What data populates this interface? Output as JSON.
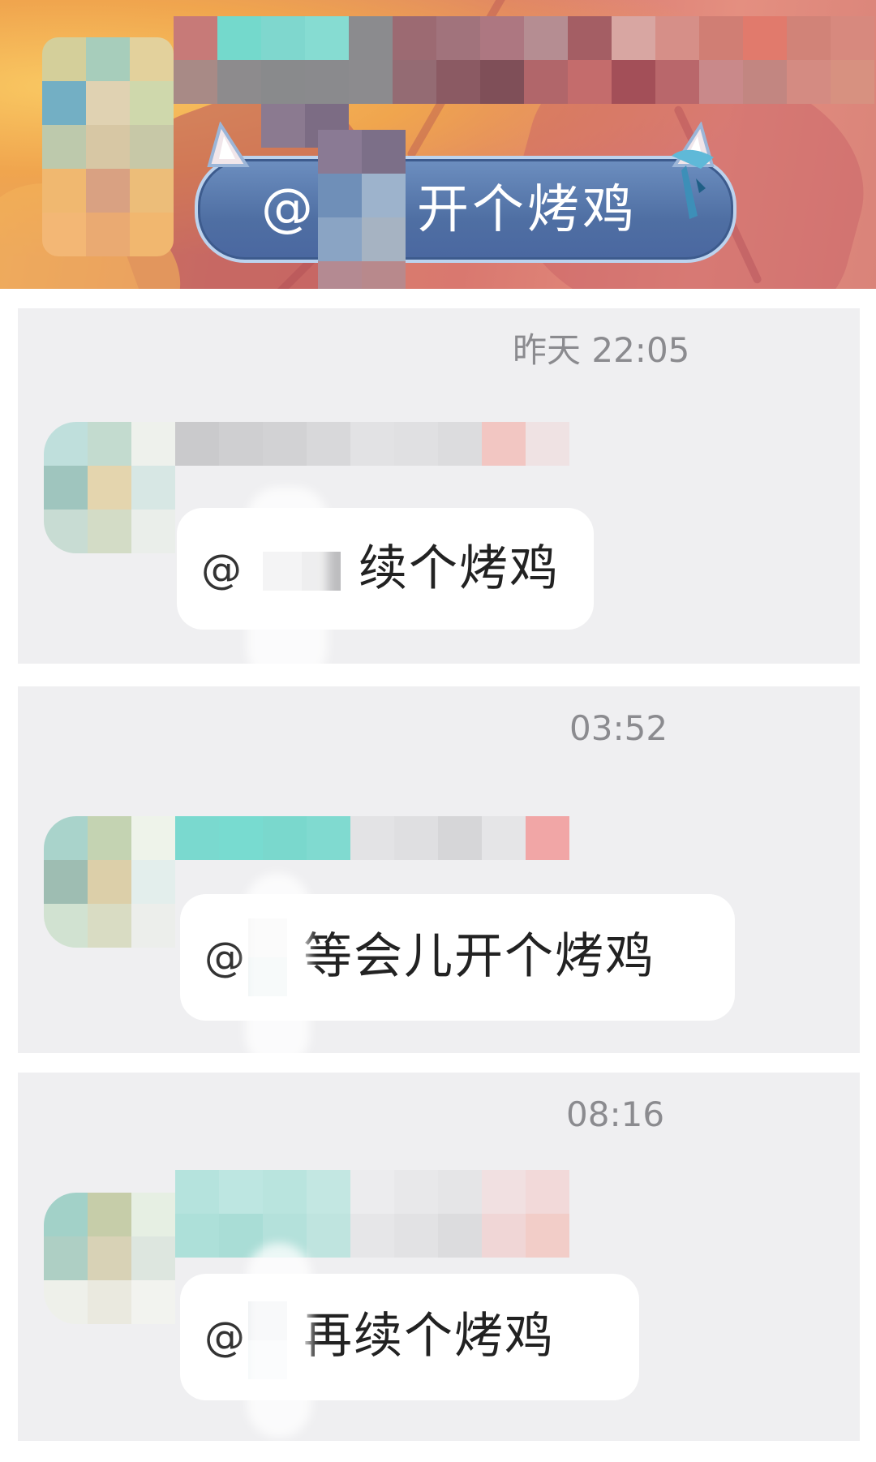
{
  "banner": {
    "at_symbol": "@",
    "text": "开个烤鸡"
  },
  "messages": [
    {
      "time": "昨天 22:05",
      "at_symbol": "@",
      "text": "续个烤鸡"
    },
    {
      "time": "03:52",
      "at_symbol": "@",
      "text": "等会儿开个烤鸡"
    },
    {
      "time": "08:16",
      "at_symbol": "@",
      "text": "再续个烤鸡"
    }
  ]
}
